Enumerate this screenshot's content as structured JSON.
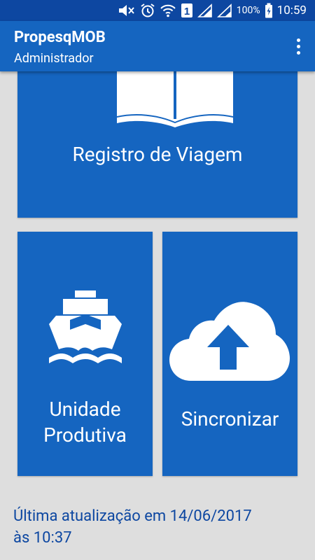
{
  "status_bar": {
    "battery_percent": "100%",
    "time": "10:59",
    "sim_badge": "1",
    "icons": [
      "mute-icon",
      "alarm-icon",
      "wifi-icon",
      "sim-icon",
      "signal-icon",
      "signal-icon",
      "battery-charging-icon"
    ]
  },
  "app_bar": {
    "title": "PropesqMOB",
    "subtitle": "Administrador",
    "menu_icon": "overflow-menu-icon"
  },
  "tiles": {
    "registro": {
      "label": "Registro de Viagem",
      "icon": "book-icon"
    },
    "unidade": {
      "label_line1": "Unidade",
      "label_line2": "Produtiva",
      "icon": "ship-icon"
    },
    "sincronizar": {
      "label": "Sincronizar",
      "icon": "cloud-upload-icon"
    }
  },
  "footer": {
    "line1": "Última atualização em 14/06/2017",
    "line2": "às 10:37"
  },
  "colors": {
    "status_bar": "#0d47a1",
    "primary": "#1565c0",
    "background": "#dedede",
    "footer_text": "#0d47a1"
  }
}
